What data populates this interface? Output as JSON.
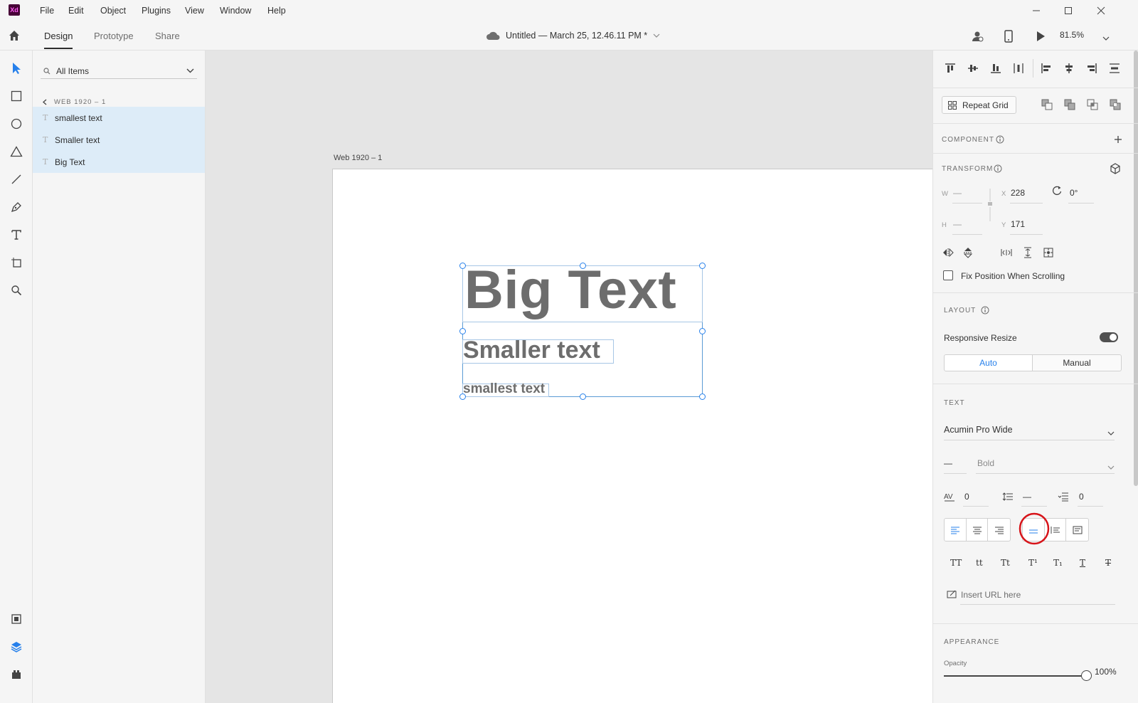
{
  "app": {
    "logo_text": "Xd"
  },
  "menu": [
    "File",
    "Edit",
    "Object",
    "Plugins",
    "View",
    "Window",
    "Help"
  ],
  "toolbar": {
    "tabs": [
      "Design",
      "Prototype",
      "Share"
    ],
    "document_title": "Untitled — March 25, 12.46.11 PM *",
    "zoom": "81.5%"
  },
  "layers": {
    "search_placeholder": "All Items",
    "breadcrumb": "WEB 1920 – 1",
    "items": [
      {
        "label": "smallest text",
        "type_glyph": "T"
      },
      {
        "label": "Smaller text",
        "type_glyph": "T"
      },
      {
        "label": "Big Text",
        "type_glyph": "T"
      }
    ]
  },
  "canvas": {
    "artboard_name": "Web 1920 – 1",
    "texts": {
      "big": "Big Text",
      "smaller": "Smaller text",
      "smallest": "smallest text"
    }
  },
  "inspector": {
    "repeat_grid": "Repeat Grid",
    "component_title": "COMPONENT",
    "transform_title": "TRANSFORM",
    "w_label": "W",
    "w_value": "—",
    "h_label": "H",
    "h_value": "—",
    "x_label": "X",
    "x_value": "228",
    "y_label": "Y",
    "y_value": "171",
    "rotation": "0°",
    "fix_position": "Fix Position When Scrolling",
    "layout_title": "LAYOUT",
    "responsive_resize": "Responsive Resize",
    "auto": "Auto",
    "manual": "Manual",
    "text_title": "TEXT",
    "font_family": "Acumin Pro Wide",
    "font_size": "—",
    "font_weight": "Bold",
    "char_spacing": "0",
    "line_spacing": "—",
    "para_spacing": "0",
    "case_labels": [
      "TT",
      "tt",
      "Tt",
      "T¹",
      "T₁",
      "T",
      "T"
    ],
    "url_placeholder": "Insert URL here",
    "appearance_title": "APPEARANCE",
    "opacity_label": "Opacity",
    "opacity_value": "100%",
    "opacity_fraction": 1.0
  },
  "colors": {
    "accent": "#2680eb",
    "selection_bg": "#ddecf8",
    "annotation": "#d7141a"
  }
}
